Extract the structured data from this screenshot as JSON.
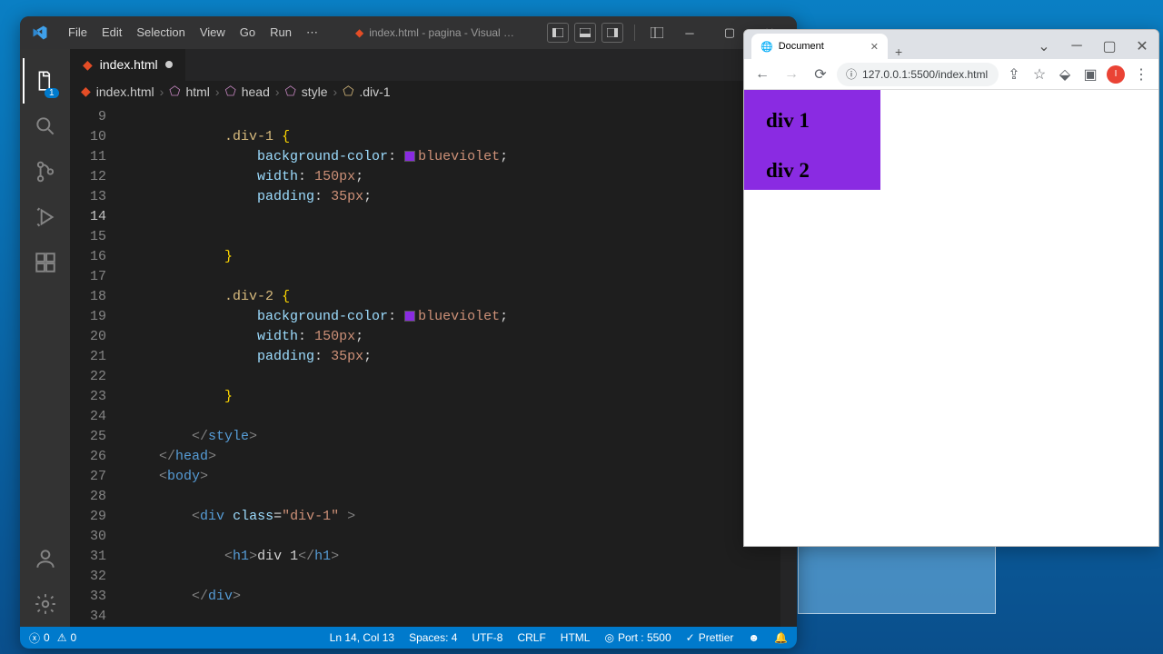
{
  "vscode": {
    "menu": {
      "file": "File",
      "edit": "Edit",
      "selection": "Selection",
      "view": "View",
      "go": "Go",
      "run": "Run"
    },
    "title": "index.html - pagina - Visual …",
    "tab_label": "index.html",
    "breadcrumb": {
      "file": "index.html",
      "p1": "html",
      "p2": "head",
      "p3": "style",
      "p4": ".div-1"
    },
    "explorer_badge": "1",
    "lines": {
      "start": 9,
      "active": 14,
      "n9": "",
      "n10": ".div-1",
      "n11_prop": "background-color",
      "n11_val": "blueviolet",
      "n12_prop": "width",
      "n12_val": "150px",
      "n13_prop": "padding",
      "n13_val": "35px",
      "n18": ".div-2",
      "n19_prop": "background-color",
      "n19_val": "blueviolet",
      "n20_prop": "width",
      "n20_val": "150px",
      "n21_prop": "padding",
      "n21_val": "35px",
      "style_close": "style",
      "head_close": "head",
      "body_open": "body",
      "div_open_tag": "div",
      "div_open_attr": "class",
      "div_open_val": "\"div-1\"",
      "h1_tag": "h1",
      "h1_text": "div 1",
      "div_close_tag": "div"
    },
    "status": {
      "errors": "0",
      "warnings": "0",
      "cursor": "Ln 14, Col 13",
      "spaces": "Spaces: 4",
      "encoding": "UTF-8",
      "eol": "CRLF",
      "lang": "HTML",
      "port": "Port : 5500",
      "formatter": "Prettier"
    }
  },
  "chrome": {
    "tab_title": "Document",
    "url": "127.0.0.1:5500/index.html",
    "divs": {
      "d1": "div 1",
      "d2": "div 2"
    }
  }
}
